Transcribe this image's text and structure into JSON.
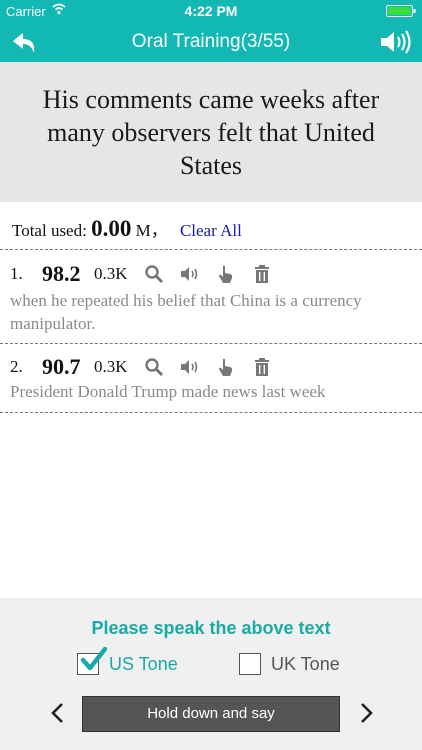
{
  "status_bar": {
    "carrier": "Carrier",
    "time": "4:22 PM"
  },
  "nav": {
    "title": "Oral Training(3/55)",
    "back_icon": "back-arrow-icon",
    "speaker_icon": "speaker-icon"
  },
  "sentence": "His comments came weeks after many observers felt that United States",
  "totals": {
    "label": "Total used:",
    "value": "0.00",
    "unit": "M，",
    "clear_label": "Clear All"
  },
  "records": [
    {
      "index": "1.",
      "score": "98.2",
      "size": "0.3K",
      "text": "when he repeated his belief that China is a currency manipulator."
    },
    {
      "index": "2.",
      "score": "90.7",
      "size": "0.3K",
      "text": "President Donald Trump made news last week"
    }
  ],
  "bottom": {
    "prompt": "Please speak the above text",
    "us_tone_label": "US Tone",
    "us_tone_checked": true,
    "uk_tone_label": "UK Tone",
    "uk_tone_checked": false,
    "hold_button_label": "Hold down and say"
  },
  "colors": {
    "accent": "#12b8b4",
    "accent_text": "#17aaa6",
    "link": "#1a1aaa",
    "record_text": "#8a8a8a"
  }
}
